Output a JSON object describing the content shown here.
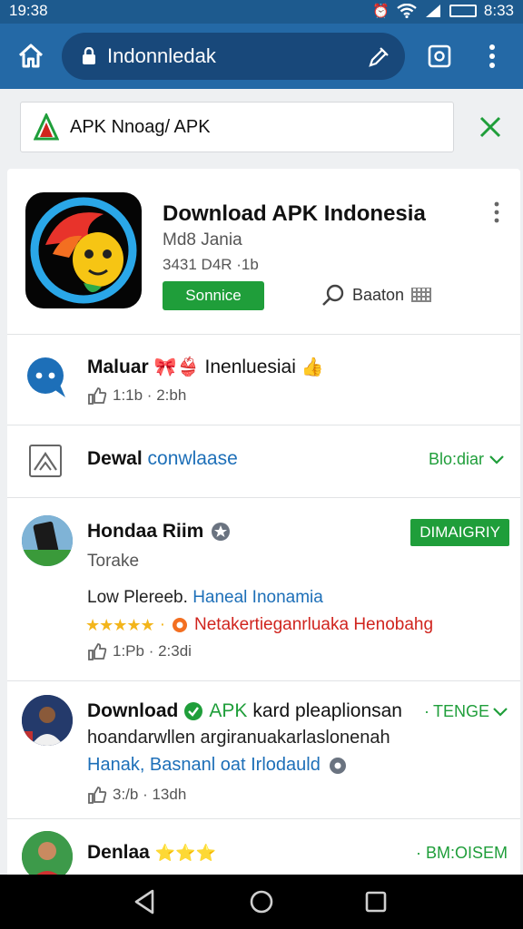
{
  "status_bar": {
    "time_left": "19:38",
    "time_right": "8:33"
  },
  "browser": {
    "url": "Indonnledak"
  },
  "search": {
    "text": "APK Nnoag/ APK"
  },
  "app": {
    "title": "Download APK Indonesia",
    "developer": "Md8 Jania",
    "meta": "3431 D4R ·1b",
    "install_label": "Sonnice",
    "search_label": "Baaton"
  },
  "section1": {
    "title": "Maluar",
    "title_emoji": "🎀👙",
    "title_tail": "Inenluesiai",
    "tail_emoji": "👍",
    "meta": "1:1b · 2:bh"
  },
  "section2": {
    "title_bold": "Dewal",
    "title_link": "conwlaase",
    "dropdown_label": "Blo:diar"
  },
  "post1": {
    "title": "Hondaa Riim",
    "tag": "DIMAIGRIY",
    "subtitle": "Torake",
    "line1_plain": "Low Plereeb.",
    "line1_link": "Haneal Inonamia",
    "stars": "★★★★★",
    "stars_dot": "·",
    "line2_red": "Netakertieganrluaka Henobahg",
    "meta": "1:Pb · 2:3di"
  },
  "post2": {
    "title_a": "Download",
    "title_b": "APK",
    "title_c": "kard pleaplionsan",
    "dropdown_label": "TENGE",
    "line2": "hoandarwllen argiranuakarlaslonenah",
    "line3": "Hanak, Basnanl oat Irlodauld",
    "meta": "3:/b · 13dh"
  },
  "post3": {
    "title": "Denlaa",
    "title_emoji": "⭐⭐⭐",
    "badge": "· BM:OISEM"
  },
  "colors": {
    "bar": "#2469a6",
    "status": "#1d5a8e",
    "green": "#1f9e3a",
    "link": "#1d6fb8",
    "red": "#d0241e"
  }
}
